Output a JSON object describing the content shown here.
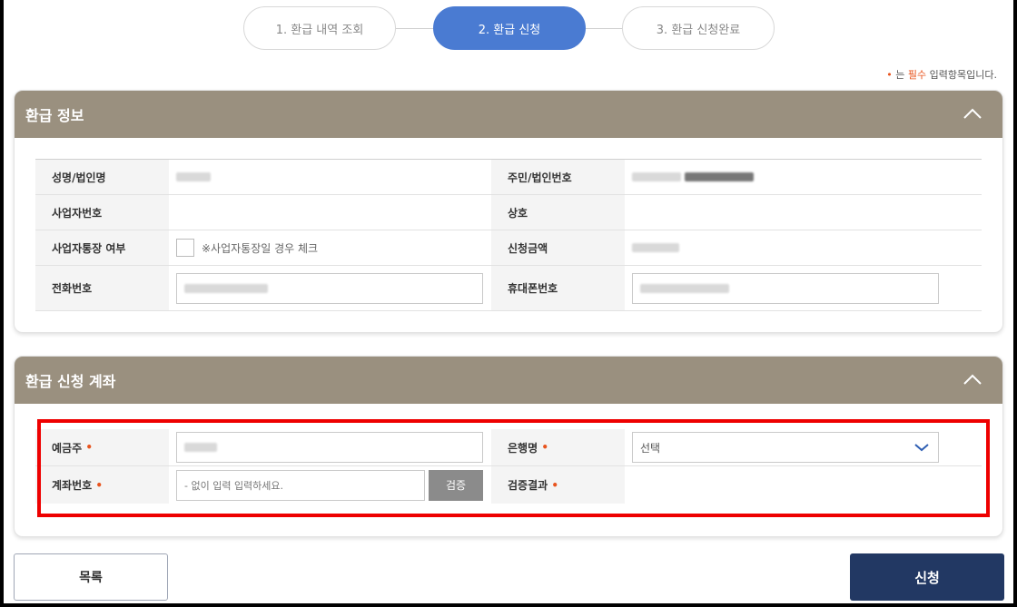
{
  "steps": [
    {
      "label": "1. 환급 내역 조회",
      "active": false
    },
    {
      "label": "2. 환급 신청",
      "active": true
    },
    {
      "label": "3. 환급 신청완료",
      "active": false
    }
  ],
  "required_note": {
    "dot": "•",
    "pre": "는 ",
    "strong": "필수",
    "post": " 입력항목입니다."
  },
  "refund_info": {
    "title": "환급 정보",
    "name_label": "성명/법인명",
    "id_label": "주민/법인번호",
    "biz_no_label": "사업자번호",
    "company_label": "상호",
    "biz_account_label": "사업자통장 여부",
    "biz_account_hint": "※사업자통장일 경우 체크",
    "amount_label": "신청금액",
    "phone_label": "전화번호",
    "mobile_label": "휴대폰번호"
  },
  "account": {
    "title": "환급 신청 계좌",
    "holder_label": "예금주",
    "bank_label": "은행명",
    "bank_selected": "선택",
    "account_no_label": "계좌번호",
    "account_placeholder": "- 없이 입력 입력하세요.",
    "verify_button": "검증",
    "verify_result_label": "검증결과",
    "required_mark": "•"
  },
  "buttons": {
    "list": "목록",
    "apply": "신청"
  },
  "colors": {
    "header": "#9a907f",
    "active_step": "#4a7bd2",
    "apply_button": "#223863",
    "required": "#e8541e",
    "highlight": "#ee0000"
  }
}
